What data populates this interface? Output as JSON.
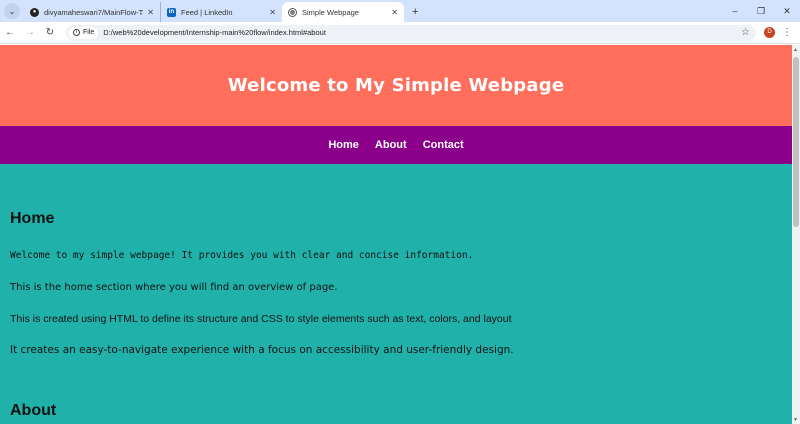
{
  "browser": {
    "tabs": [
      {
        "title": "divyamaheswari7/MainFlow-Ta",
        "icon": "github-icon"
      },
      {
        "title": "Feed | LinkedIn",
        "icon": "linkedin-icon"
      },
      {
        "title": "Simple Webpage",
        "icon": "globe-icon",
        "active": true
      }
    ],
    "new_tab_label": "+",
    "address": {
      "scheme_chip": "File",
      "url": "D:/web%20development/Internship-main%20flow/index.html#about"
    },
    "profile_initial": "D",
    "window_controls": [
      "–",
      "❐",
      "✕"
    ]
  },
  "page": {
    "header_title": "Welcome to My Simple Webpage",
    "nav": [
      "Home",
      "About",
      "Contact"
    ],
    "home": {
      "title": "Home",
      "paragraphs": [
        "Welcome to my simple webpage! It provides you with clear and concise information.",
        "This is the home section where you will find an overview of page.",
        "This is created using HTML to define its structure and CSS to style elements such as text, colors, and layout",
        "It creates an easy-to-navigate experience with a focus on accessibility and user-friendly design."
      ]
    },
    "about": {
      "title": "About"
    }
  },
  "colors": {
    "header_bg": "#ff6f5c",
    "nav_bg": "#8b008b",
    "content_bg": "#20b2aa"
  }
}
